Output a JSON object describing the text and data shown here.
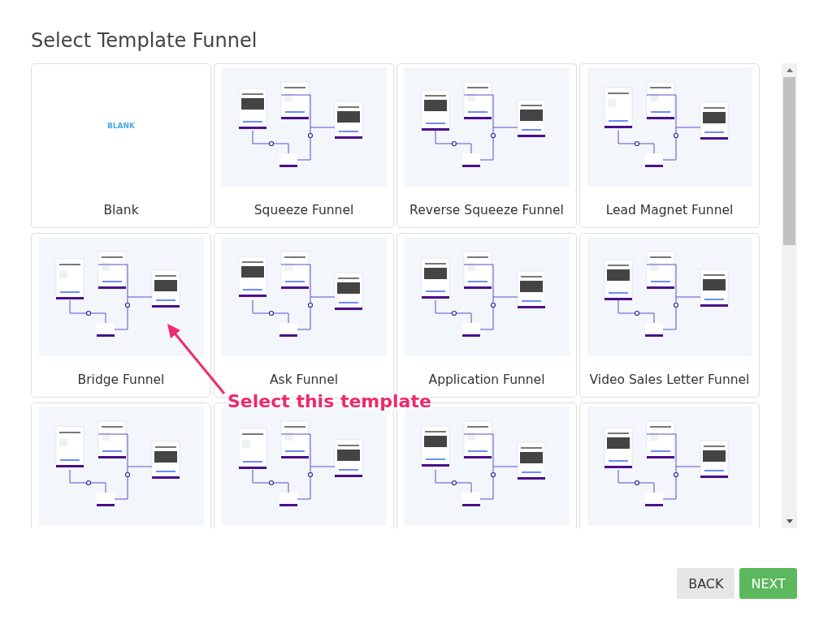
{
  "title": "Select Template Funnel",
  "templates": [
    {
      "kind": "blank",
      "preview_text": "BLANK",
      "label": "Blank"
    },
    {
      "kind": "diagram",
      "label": "Squeeze Funnel"
    },
    {
      "kind": "diagram",
      "label": "Reverse Squeeze Funnel"
    },
    {
      "kind": "diagram",
      "label": "Lead Magnet Funnel"
    },
    {
      "kind": "diagram",
      "label": "Bridge Funnel"
    },
    {
      "kind": "diagram",
      "label": "Ask Funnel"
    },
    {
      "kind": "diagram",
      "label": "Application Funnel"
    },
    {
      "kind": "diagram",
      "label": "Video Sales Letter Funnel"
    },
    {
      "kind": "diagram"
    },
    {
      "kind": "diagram"
    },
    {
      "kind": "diagram"
    },
    {
      "kind": "diagram"
    }
  ],
  "annotation": {
    "text": "Select this template"
  },
  "buttons": [
    {
      "kind": "back",
      "label": "BACK"
    },
    {
      "kind": "next",
      "label": "NEXT"
    }
  ]
}
